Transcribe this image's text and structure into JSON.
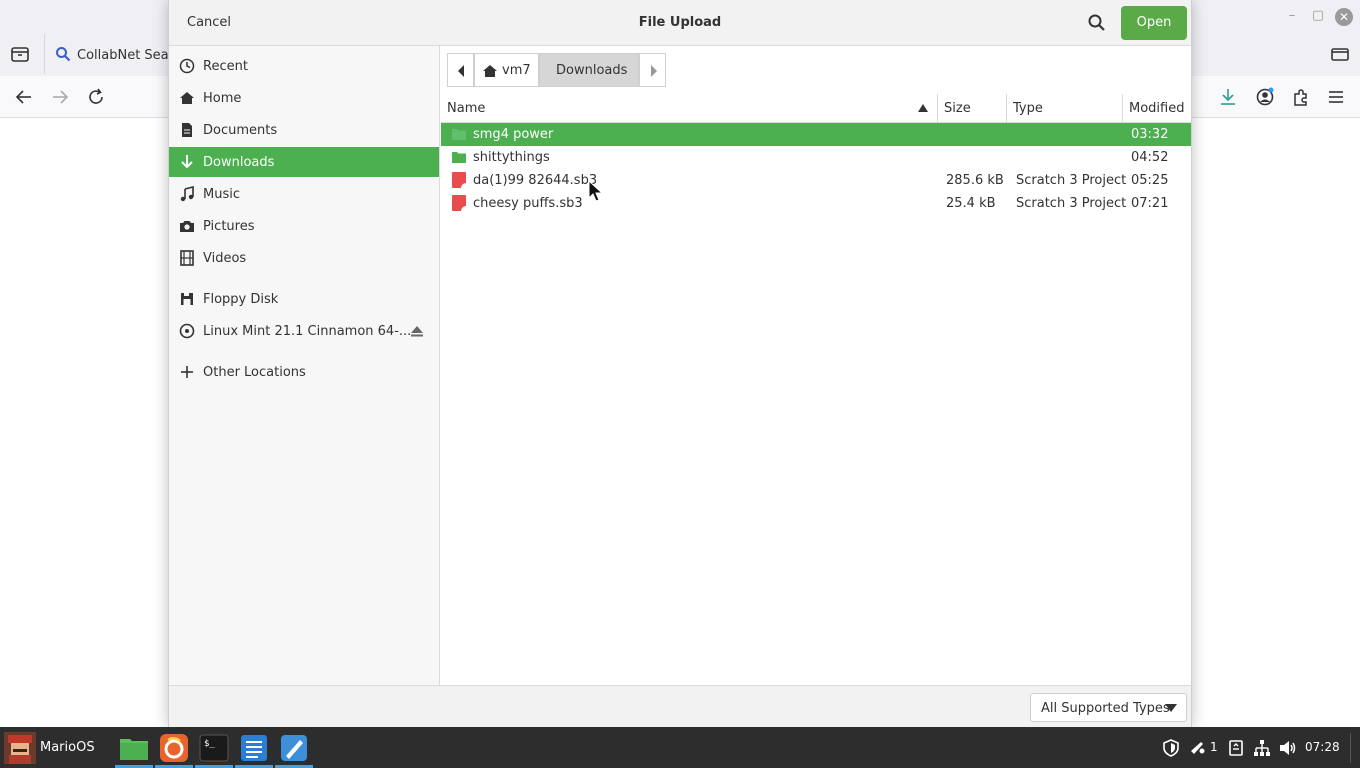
{
  "browser": {
    "tab_title": "CollabNet Sear",
    "window_controls": {
      "minimize": "–",
      "maximize": "▢",
      "close": "✕"
    }
  },
  "dialog": {
    "title": "File Upload",
    "cancel_label": "Cancel",
    "open_label": "Open",
    "sidebar": {
      "items": [
        {
          "label": "Recent",
          "icon": "clock-icon"
        },
        {
          "label": "Home",
          "icon": "home-icon"
        },
        {
          "label": "Documents",
          "icon": "document-icon"
        },
        {
          "label": "Downloads",
          "icon": "download-icon",
          "active": true
        },
        {
          "label": "Music",
          "icon": "music-icon"
        },
        {
          "label": "Pictures",
          "icon": "camera-icon"
        },
        {
          "label": "Videos",
          "icon": "film-icon"
        },
        {
          "label": "Floppy Disk",
          "icon": "floppy-icon"
        },
        {
          "label": "Linux Mint 21.1 Cinnamon 64-...",
          "icon": "disc-icon"
        },
        {
          "label": "Other Locations",
          "icon": "plus-icon"
        }
      ]
    },
    "pathbar": {
      "segments": [
        {
          "label": "vm7",
          "icon": "home-icon"
        },
        {
          "label": "Downloads",
          "current": true
        }
      ]
    },
    "columns": {
      "name": "Name",
      "size": "Size",
      "type": "Type",
      "modified": "Modified"
    },
    "files": [
      {
        "name": "smg4 power",
        "size": "",
        "type": "",
        "modified": "03:32",
        "kind": "folder",
        "selected": true
      },
      {
        "name": "shittythings",
        "size": "",
        "type": "",
        "modified": "04:52",
        "kind": "folder"
      },
      {
        "name": "da(1)99 82644.sb3",
        "size": "285.6 kB",
        "type": "Scratch 3 Project",
        "modified": "05:25",
        "kind": "scratch"
      },
      {
        "name": "cheesy puffs.sb3",
        "size": "25.4 kB",
        "type": "Scratch 3 Project",
        "modified": "07:21",
        "kind": "scratch"
      }
    ],
    "filter_label": "All Supported Types"
  },
  "taskbar": {
    "menu_label": "MarioOS",
    "notification_count": "1",
    "clock": "07:28"
  },
  "colors": {
    "accent_green": "#4caf50",
    "open_button": "#5aaa47",
    "scratch_red": "#e84c4c",
    "taskbar": "#2d2d2d"
  }
}
